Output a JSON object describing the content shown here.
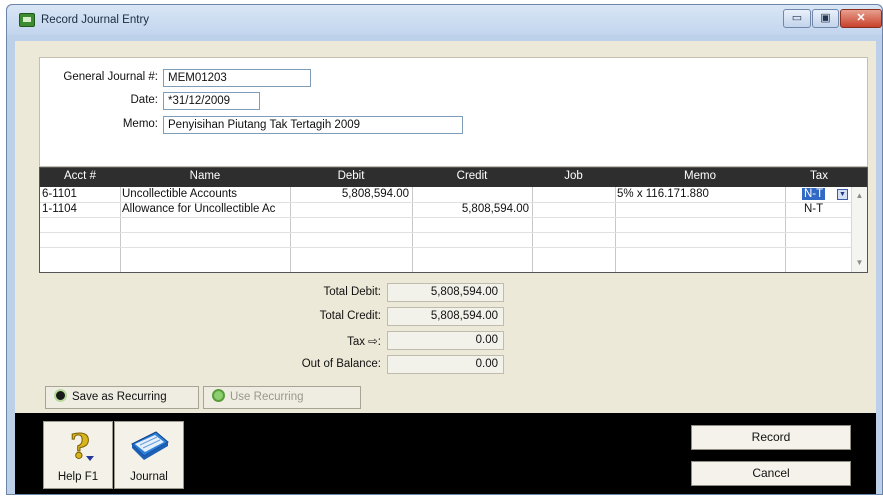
{
  "window": {
    "title": "Record Journal Entry",
    "controls": {
      "minimize": "▭",
      "maximize": "▣",
      "close": "✕"
    }
  },
  "header": {
    "journal_label": "General Journal #:",
    "journal_value": "MEM01203",
    "date_label": "Date:",
    "date_value": "*31/12/2009",
    "memo_label": "Memo:",
    "memo_value": "Penyisihan Piutang Tak Tertagih 2009"
  },
  "grid": {
    "columns": [
      "Acct #",
      "Name",
      "Debit",
      "Credit",
      "Job",
      "Memo",
      "Tax"
    ],
    "rows": [
      {
        "acct": "6-1101",
        "name": "Uncollectible Accounts",
        "debit": "5,808,594.00",
        "credit": "",
        "job": "",
        "memo": "5% x 116.171.880",
        "tax": "N-T"
      },
      {
        "acct": "1-1104",
        "name": "Allowance for Uncollectible Ac",
        "debit": "",
        "credit": "5,808,594.00",
        "job": "",
        "memo": "",
        "tax": "N-T"
      }
    ],
    "scroll": {
      "up": "▲",
      "down": "▼"
    },
    "tax_dropdown": "▼"
  },
  "totals": {
    "total_debit_label": "Total Debit:",
    "total_debit_value": "5,808,594.00",
    "total_credit_label": "Total Credit:",
    "total_credit_value": "5,808,594.00",
    "tax_label": "Tax ⇨:",
    "tax_value": "0.00",
    "out_of_balance_label": "Out of Balance:",
    "out_of_balance_value": "0.00"
  },
  "recurring": {
    "save_label": "Save as Recurring",
    "use_label": "Use Recurring"
  },
  "toolbar": {
    "help_label": "Help F1",
    "journal_label": "Journal",
    "record_label": "Record",
    "cancel_label": "Cancel"
  },
  "colors": {
    "accent": "#316ac5",
    "grid_header": "#2e2e2e",
    "client_bg": "#ece9d8"
  }
}
